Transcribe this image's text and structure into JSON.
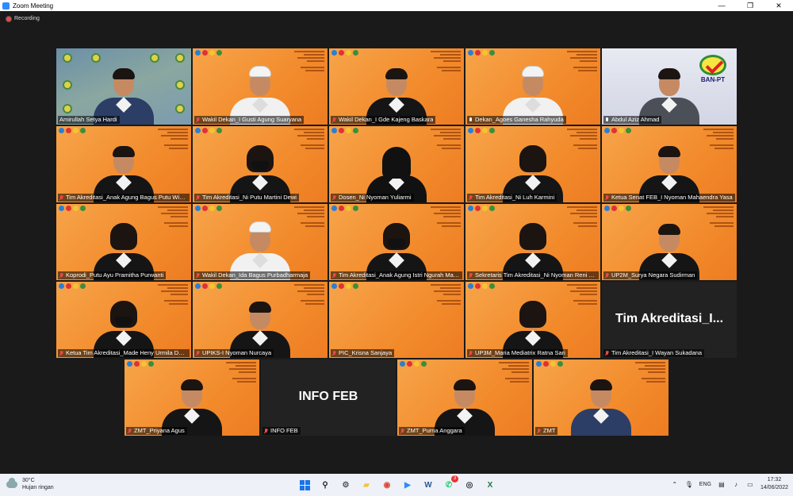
{
  "window": {
    "title": "Zoom Meeting",
    "minimize": "—",
    "restore": "❐",
    "close": "✕"
  },
  "recording": {
    "label": "Recording"
  },
  "participants": [
    {
      "name": "Amirullah Setya Hardi",
      "bg": "logos",
      "mic": "on",
      "style": "navy"
    },
    {
      "name": "Wakil Dekan_I Gusti Agung Suaryana",
      "bg": "orange",
      "mic": "off",
      "style": "white udeng"
    },
    {
      "name": "Wakil Dekan_I Gde Kajeng Baskara",
      "bg": "orange",
      "mic": "off",
      "style": "black"
    },
    {
      "name": "Dekan_Agoes Ganesha Rahyuda",
      "bg": "orange",
      "mic": "on",
      "style": "white udeng"
    },
    {
      "name": "Abdul Aziz Ahmad",
      "bg": "banpt",
      "mic": "on",
      "style": "grey"
    },
    {
      "name": "Tim Akreditasi_Anak Agung Bagus Putu Widanaputra",
      "bg": "orange",
      "mic": "off",
      "style": "black"
    },
    {
      "name": "Tim Akreditasi_Ni Putu Martini Dewi",
      "bg": "orange",
      "mic": "off",
      "style": "black long mask"
    },
    {
      "name": "Dosen_Ni Nyoman Yuliarmi",
      "bg": "orange",
      "mic": "off",
      "style": "veil"
    },
    {
      "name": "Tim Akreditasi_Ni Luh Karmini",
      "bg": "orange",
      "mic": "off",
      "style": "black long"
    },
    {
      "name": "Ketua Senat FEB_I Nyoman Mahaendra Yasa",
      "bg": "orange",
      "mic": "off",
      "style": "black"
    },
    {
      "name": "Koprodi_Putu Ayu Pramitha Purwanti",
      "bg": "orange",
      "mic": "off",
      "style": "black long"
    },
    {
      "name": "Wakil Dekan_Ida Bagus Purbadharmaja",
      "bg": "orange",
      "mic": "off",
      "style": "white udeng"
    },
    {
      "name": "Tim Akreditasi_Anak Agung Istri Ngurah Marhaeni",
      "bg": "orange",
      "mic": "off",
      "style": "black long mask"
    },
    {
      "name": "Sekretaris Tim Akreditasi_Ni Nyoman Reni Suasih",
      "bg": "orange",
      "mic": "off",
      "style": "black long"
    },
    {
      "name": "UP2M_Surya Negara Sudirman",
      "bg": "orange",
      "mic": "off",
      "style": "black"
    },
    {
      "name": "Ketua Tim Akreditasi_Made Heny Urmila Dewi",
      "bg": "orange",
      "mic": "off",
      "style": "black long mask"
    },
    {
      "name": "UPIKS-I Nyoman Nurcaya",
      "bg": "orange",
      "mic": "off",
      "style": "black"
    },
    {
      "name": "PIC_Krisna Sanjaya",
      "bg": "orange",
      "mic": "off",
      "style": "none"
    },
    {
      "name": "UP3M_Maria Mediatrix Ratna Sari",
      "bg": "orange",
      "mic": "off",
      "style": "black long"
    },
    {
      "name": "Tim Akreditasi_I Wayan Sukadana",
      "bg": "blank",
      "mic": "off",
      "style": "none",
      "display": "Tim  Akreditasi_I..."
    },
    {
      "name": "ZMT_Priyana Agus",
      "bg": "orange",
      "mic": "off",
      "style": "black"
    },
    {
      "name": "INFO FEB",
      "bg": "blank",
      "mic": "off",
      "style": "none",
      "display": "INFO FEB"
    },
    {
      "name": "ZMT_Purna Anggara",
      "bg": "orange",
      "mic": "off",
      "style": "black"
    },
    {
      "name": "ZMT",
      "bg": "orange",
      "mic": "off",
      "style": "navy"
    }
  ],
  "taskbar": {
    "weather_temp": "30°C",
    "weather_desc": "Hujan ringan",
    "apps": [
      {
        "icon": "windows-start-icon",
        "glyph": ""
      },
      {
        "icon": "search-icon",
        "glyph": "⚲"
      },
      {
        "icon": "settings-icon",
        "glyph": "⚙"
      },
      {
        "icon": "file-explorer-icon",
        "glyph": "▰"
      },
      {
        "icon": "chrome-icon",
        "glyph": "◉"
      },
      {
        "icon": "zoom-icon",
        "glyph": "▶"
      },
      {
        "icon": "word-icon",
        "glyph": "W"
      },
      {
        "icon": "whatsapp-icon",
        "glyph": "✆",
        "badge": "3"
      },
      {
        "icon": "camera-icon",
        "glyph": "◎"
      },
      {
        "icon": "excel-icon",
        "glyph": "X"
      }
    ],
    "language": "ENG",
    "time": "17:32",
    "date": "14/06/2022"
  }
}
